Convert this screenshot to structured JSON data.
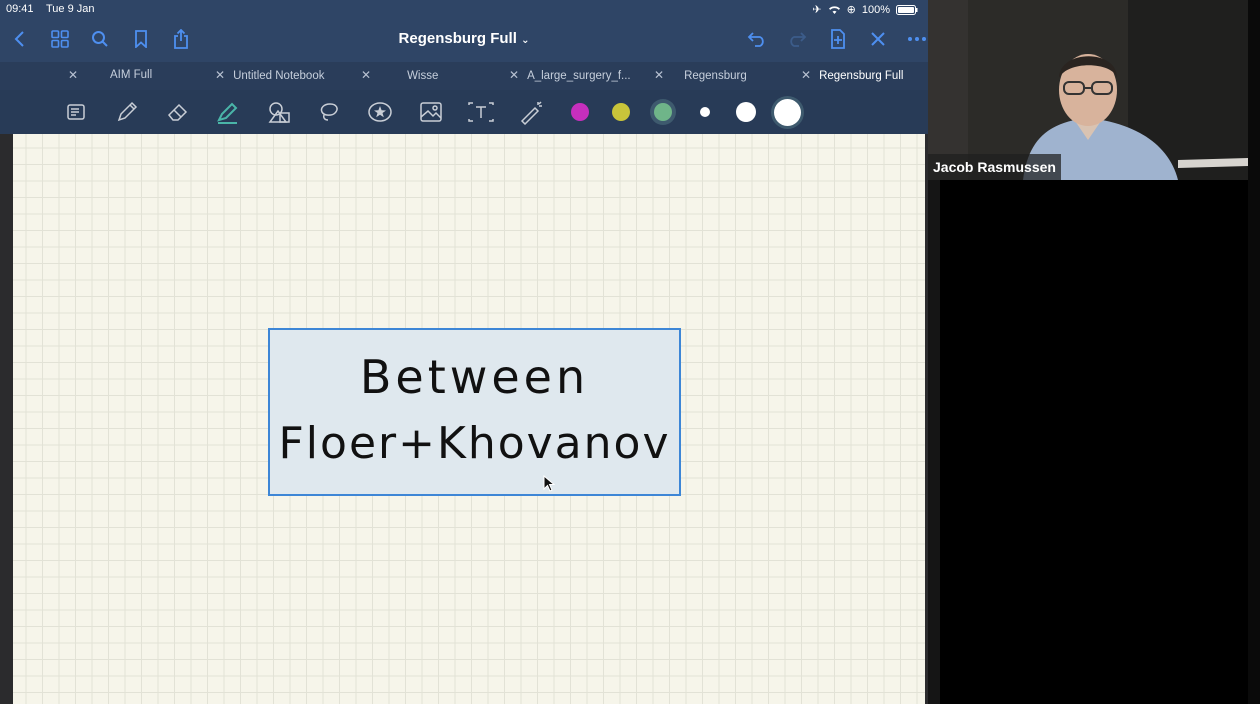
{
  "status_bar": {
    "time": "09:41",
    "date": "Tue 9 Jan",
    "battery": "100%"
  },
  "navbar": {
    "document_title": "Regensburg Full"
  },
  "tabs": [
    {
      "label": "AIM Full"
    },
    {
      "label": "Untitled Notebook"
    },
    {
      "label": "Wisse"
    },
    {
      "label": "A_large_surgery_f..."
    },
    {
      "label": "Regensburg"
    },
    {
      "label": "Regensburg  Full"
    }
  ],
  "toolbar": {
    "colors": [
      "#c62fbd",
      "#c8c43a",
      "#6fb589"
    ],
    "tools": [
      "scan-tool",
      "pen",
      "eraser",
      "highlighter",
      "shapes",
      "lasso",
      "elements",
      "image",
      "text",
      "laser-pointer"
    ]
  },
  "canvas": {
    "line1": "Between",
    "line2": "Floer+Khovanov"
  },
  "video": {
    "participant_name": "Jacob Rasmussen"
  }
}
